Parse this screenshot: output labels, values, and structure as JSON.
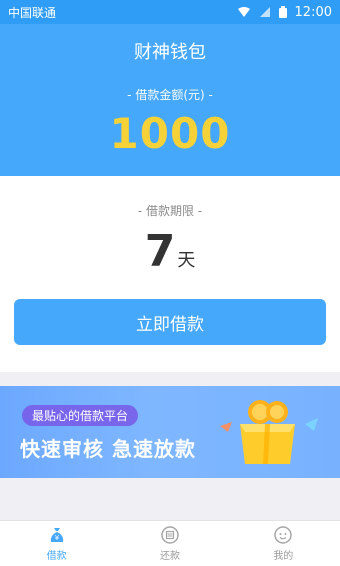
{
  "statusbar": {
    "carrier": "中国联通",
    "time": "12:00"
  },
  "hero": {
    "title": "财神钱包",
    "amount_label": "- 借款金额(元) -",
    "amount_value": "1000"
  },
  "term": {
    "label": "- 借款期限 -",
    "number": "7",
    "unit": "天"
  },
  "apply_button": {
    "label": "立即借款"
  },
  "banner": {
    "badge": "最贴心的借款平台",
    "slogan": "快速审核  急速放款"
  },
  "tabbar": {
    "tabs": [
      {
        "label": "借款",
        "icon": "loan-bag-icon",
        "active": true
      },
      {
        "label": "还款",
        "icon": "repay-icon",
        "active": false
      },
      {
        "label": "我的",
        "icon": "profile-icon",
        "active": false
      }
    ]
  },
  "colors": {
    "primary": "#46a8fa",
    "amount": "#f6d138",
    "background": "#efeff4"
  }
}
